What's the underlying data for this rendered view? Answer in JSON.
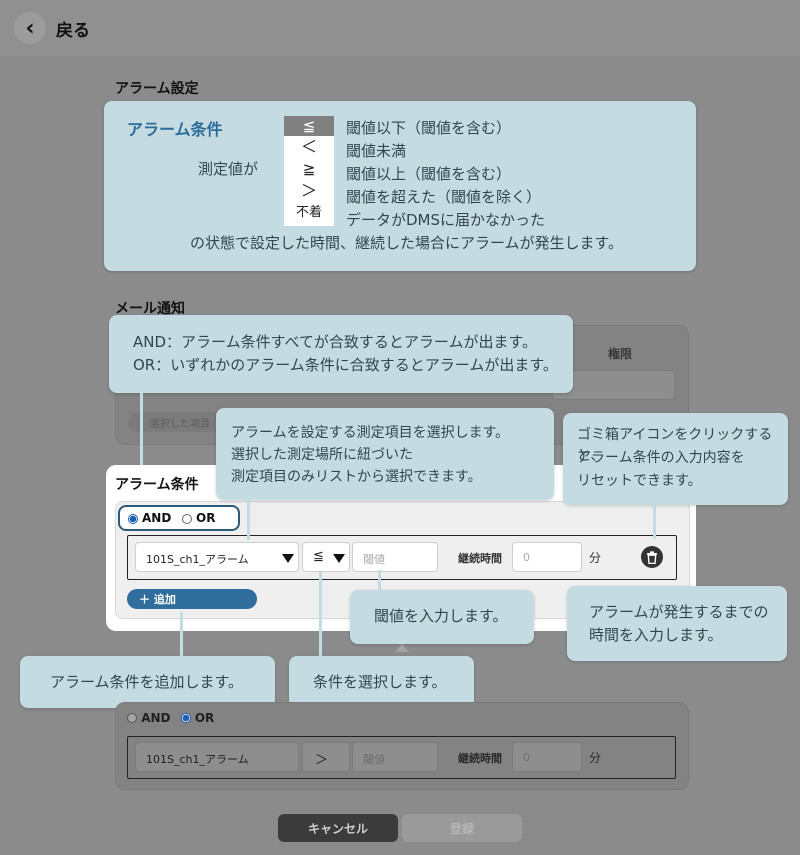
{
  "header": {
    "back_label": "戻る"
  },
  "alarm_settings": {
    "title": "アラーム設定"
  },
  "condition_callout": {
    "title": "アラーム条件",
    "measured_value_label": "測定値が",
    "operators": [
      {
        "symbol": "≦",
        "description": "閾値以下（閾値を含む）"
      },
      {
        "symbol": "＜",
        "description": "閾値未満"
      },
      {
        "symbol": "≧",
        "description": "閾値以上（閾値を含む）"
      },
      {
        "symbol": "＞",
        "description": "閾値を超えた（閾値を除く）"
      },
      {
        "symbol": "不着",
        "description": "データがDMSに届かなかった"
      }
    ],
    "footer": "の状態で設定した時間、継続した場合にアラームが発生します。"
  },
  "mail_notice": {
    "title": "メール通知",
    "column_permission": "権限",
    "selected_hint": "選択した項目"
  },
  "andor_callout": {
    "line1": "AND：アラーム条件すべてが合致するとアラームが出ます。",
    "line2": "OR：いずれかのアラーム条件に合致するとアラームが出ます。"
  },
  "item_callout": {
    "line1": "アラームを設定する測定項目を選択します。",
    "line2": "選択した測定場所に紐づいた",
    "line3": "測定項目のみリストから選択できます。"
  },
  "trash_callout": {
    "line1": "ゴミ箱アイコンをクリックすると、",
    "line2": "アラーム条件の入力内容を",
    "line3": "リセットできます。"
  },
  "threshold_callout": {
    "text": "閾値を入力します。"
  },
  "duration_callout": {
    "line1": "アラームが発生するまでの",
    "line2": "時間を入力します。"
  },
  "add_callout": {
    "text": "アラーム条件を追加します。"
  },
  "operator_callout": {
    "text": "条件を選択します。"
  },
  "alarm_condition_1": {
    "title": "アラーム条件",
    "and_label": "AND",
    "or_label": "OR",
    "selected_logic": "AND",
    "item_value": "101S_ch1_アラーム",
    "operator_value": "≦",
    "threshold_placeholder": "閾値",
    "duration_label": "継続時間",
    "duration_placeholder": "0",
    "duration_unit": "分",
    "add_button": "＋ 追加"
  },
  "alarm_condition_2": {
    "and_label": "AND",
    "or_label": "OR",
    "selected_logic": "OR",
    "item_value": "101S_ch1_アラーム",
    "operator_value": "＞",
    "threshold_placeholder": "閾値",
    "duration_label": "継続時間",
    "duration_placeholder": "0",
    "duration_unit": "分"
  },
  "footer_buttons": {
    "cancel": "キャンセル",
    "register": "登録"
  },
  "colors": {
    "overlay_gray": "#8b8b8b",
    "callout_bg": "#c3dbe1",
    "callout_title": "#2d6c9a",
    "add_button": "#2f6e9c",
    "radio_active": "#1a5fb4"
  }
}
